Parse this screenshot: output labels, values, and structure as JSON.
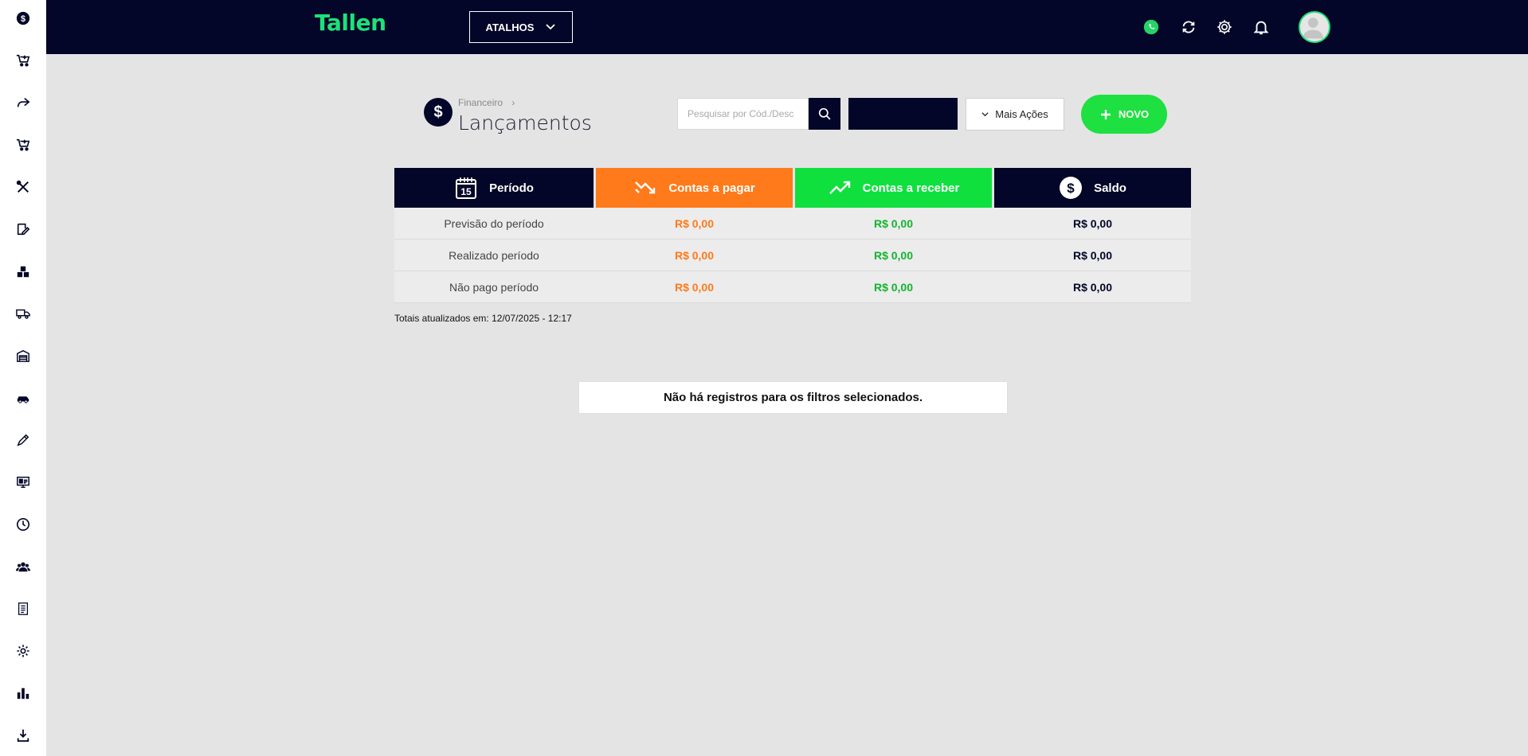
{
  "app": {
    "logo": "Tallen",
    "brand_color": "#1ee07a",
    "topbar_color": "#030628"
  },
  "topbar": {
    "atalhos_label": "ATALHOS",
    "icons": [
      "whatsapp-icon",
      "refresh-icon",
      "gear-icon",
      "bell-icon",
      "avatar"
    ]
  },
  "sidebar": {
    "icons": [
      "dollar-icon",
      "cart-add-icon",
      "share-arrow-icon",
      "cart-add-icon",
      "tools-icon",
      "edit-note-icon",
      "boxes-icon",
      "truck-icon",
      "warehouse-icon",
      "car-icon",
      "pencil-icon",
      "monitor-icon",
      "clock-icon",
      "users-icon",
      "document-icon",
      "settings-icon",
      "bar-chart-icon",
      "download-icon"
    ]
  },
  "header": {
    "breadcrumb": "Financeiro",
    "breadcrumb_sep": "›",
    "title": "Lançamentos",
    "icon_symbol": "$"
  },
  "search": {
    "placeholder": "Pesquisar por Cód./Desc",
    "value": ""
  },
  "actions": {
    "mais_acoes": "Mais Ações",
    "novo": "NOVO"
  },
  "summary": {
    "headers": {
      "periodo": "Período",
      "periodo_day": "15",
      "pagar": "Contas a pagar",
      "receber": "Contas a receber",
      "saldo": "Saldo"
    },
    "rows": [
      {
        "label": "Previsão do período",
        "pagar": "R$ 0,00",
        "receber": "R$ 0,00",
        "saldo": "R$ 0,00"
      },
      {
        "label": "Realizado período",
        "pagar": "R$ 0,00",
        "receber": "R$ 0,00",
        "saldo": "R$ 0,00"
      },
      {
        "label": "Não pago período",
        "pagar": "R$ 0,00",
        "receber": "R$ 0,00",
        "saldo": "R$ 0,00"
      }
    ],
    "colors": {
      "pagar": "#ff7a1a",
      "receber": "#0fe03e",
      "saldo": "#030628"
    }
  },
  "totais": "Totais atualizados em: 12/07/2025 - 12:17",
  "empty_message": "Não há registros para os filtros selecionados."
}
